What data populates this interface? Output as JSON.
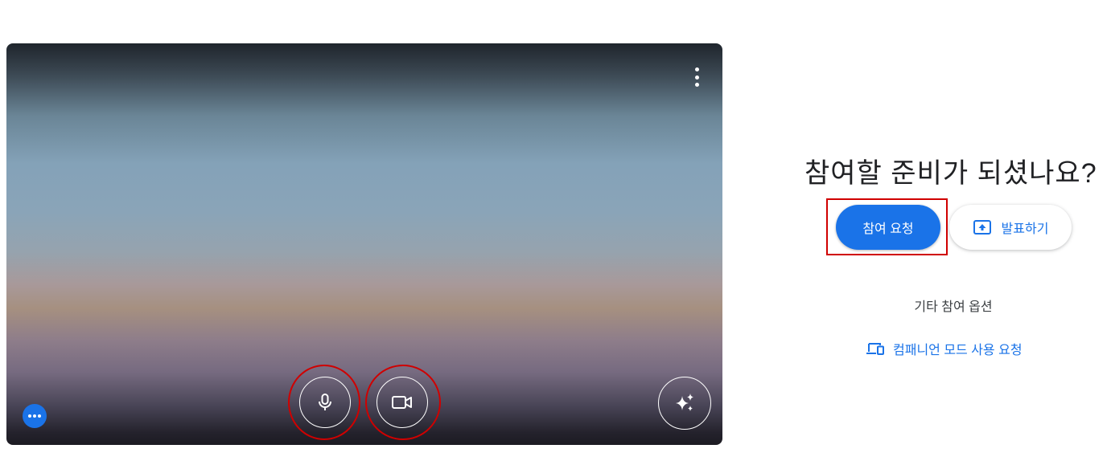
{
  "preview": {
    "more_options_icon": "more-vert-icon",
    "mic_icon": "microphone-icon",
    "camera_icon": "videocam-icon",
    "effects_icon": "sparkle-icon",
    "overflow_icon": "more-horiz-icon"
  },
  "join_panel": {
    "heading": "참여할 준비가 되셨나요?",
    "join_label": "참여 요청",
    "present_label": "발표하기",
    "present_icon": "present-to-all-icon",
    "other_options_label": "기타 참여 옵션",
    "companion_label": "컴패니언 모드 사용 요청",
    "companion_icon": "devices-icon"
  },
  "colors": {
    "accent": "#1a73e8",
    "highlight": "#d00000",
    "text": "#202124"
  }
}
